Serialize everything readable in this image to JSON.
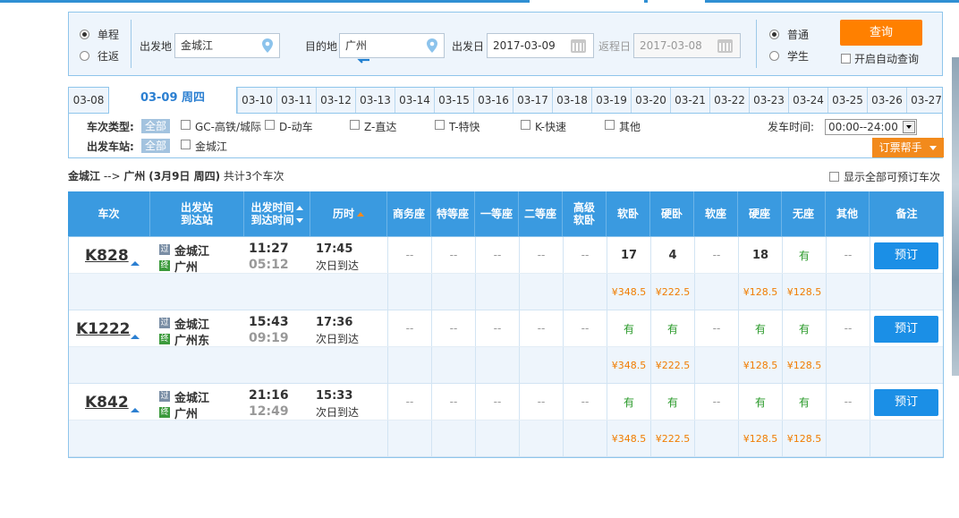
{
  "search": {
    "trip_oneway": "单程",
    "trip_round": "往返",
    "from_label": "出发地",
    "from_value": "金城江",
    "to_label": "目的地",
    "to_value": "广州",
    "depart_label": "出发日",
    "depart_value": "2017-03-09",
    "return_label": "返程日",
    "return_value": "2017-03-08",
    "ticket_normal": "普通",
    "ticket_student": "学生",
    "query_button": "查询",
    "auto_query": "开启自动查询"
  },
  "date_tabs": [
    "03-08",
    "03-09 周四",
    "03-10",
    "03-11",
    "03-12",
    "03-13",
    "03-14",
    "03-15",
    "03-16",
    "03-17",
    "03-18",
    "03-19",
    "03-20",
    "03-21",
    "03-22",
    "03-23",
    "03-24",
    "03-25",
    "03-26",
    "03-27"
  ],
  "filter": {
    "type_label": "车次类型:",
    "station_label": "出发车站:",
    "all_tag": "全部",
    "types": [
      "GC-高铁/城际",
      "D-动车",
      "Z-直达",
      "T-特快",
      "K-快速",
      "其他"
    ],
    "station": "金城江",
    "depart_time_label": "发车时间:",
    "depart_time_value": "00:00--24:00",
    "helper_button": "订票帮手"
  },
  "route": {
    "from": "金城江",
    "arrow": "-->",
    "to": "广州",
    "date": "(3月9日  周四)",
    "count_text": "共计3个车次",
    "show_all": "显示全部可预订车次"
  },
  "table_headers": {
    "train": "车次",
    "station_a": "出发站",
    "station_b": "到达站",
    "time_a": "出发时间",
    "time_b": "到达时间",
    "duration": "历时",
    "swz": "商务座",
    "tdz": "特等座",
    "ydz": "一等座",
    "edz": "二等座",
    "gjrw_a": "高级",
    "gjrw_b": "软卧",
    "rw": "软卧",
    "yw": "硬卧",
    "rz": "软座",
    "yz": "硬座",
    "wz": "无座",
    "qt": "其他",
    "remark": "备注"
  },
  "trains": [
    {
      "no": "K828",
      "from_station": "金城江",
      "to_station": "广州",
      "depart": "11:27",
      "arrive": "05:12",
      "duration": "17:45",
      "arrival_day": "次日到达",
      "seats": [
        "--",
        "--",
        "--",
        "--",
        "--",
        "17",
        "4",
        "--",
        "18",
        "有",
        "--"
      ],
      "prices": [
        "",
        "",
        "",
        "",
        "",
        "¥348.5",
        "¥222.5",
        "",
        "¥128.5",
        "¥128.5",
        ""
      ],
      "book": "预订",
      "pass_icon": "过",
      "end_icon": "终"
    },
    {
      "no": "K1222",
      "from_station": "金城江",
      "to_station": "广州东",
      "depart": "15:43",
      "arrive": "09:19",
      "duration": "17:36",
      "arrival_day": "次日到达",
      "seats": [
        "--",
        "--",
        "--",
        "--",
        "--",
        "有",
        "有",
        "--",
        "有",
        "有",
        "--"
      ],
      "prices": [
        "",
        "",
        "",
        "",
        "",
        "¥348.5",
        "¥222.5",
        "",
        "¥128.5",
        "¥128.5",
        ""
      ],
      "book": "预订",
      "pass_icon": "过",
      "end_icon": "终"
    },
    {
      "no": "K842",
      "from_station": "金城江",
      "to_station": "广州",
      "depart": "21:16",
      "arrive": "12:49",
      "duration": "15:33",
      "arrival_day": "次日到达",
      "seats": [
        "--",
        "--",
        "--",
        "--",
        "--",
        "有",
        "有",
        "--",
        "有",
        "有",
        "--"
      ],
      "prices": [
        "",
        "",
        "",
        "",
        "",
        "¥348.5",
        "¥222.5",
        "",
        "¥128.5",
        "¥128.5",
        ""
      ],
      "book": "预订",
      "pass_icon": "过",
      "end_icon": "终"
    }
  ],
  "colors": {
    "header_blue": "#3a9ae0",
    "query_orange": "#ff8000",
    "book_blue": "#1b8fe6",
    "price_orange": "#f07d00",
    "available_green": "#2a9a2a"
  }
}
